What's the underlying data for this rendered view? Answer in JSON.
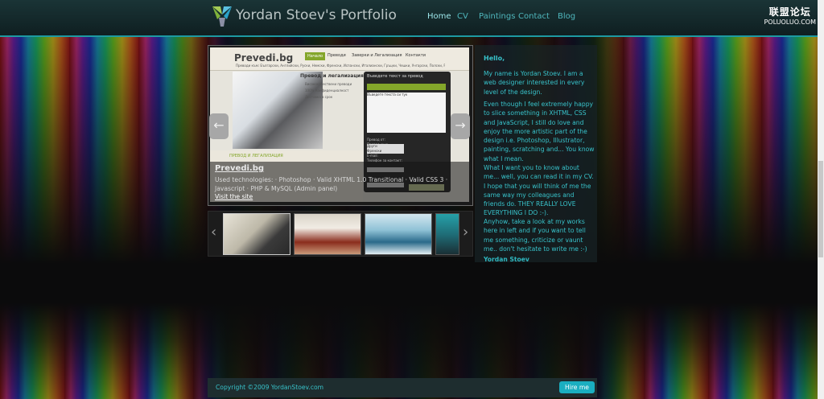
{
  "header": {
    "title": "Yordan Stoev's Portfolio",
    "nav": [
      {
        "label": "Home",
        "active": true
      },
      {
        "label": "CV",
        "active": false
      },
      {
        "label": "Paintings",
        "active": false
      },
      {
        "label": "Contact",
        "active": false
      },
      {
        "label": "Blog",
        "active": false
      }
    ]
  },
  "watermark": {
    "line1": "联盟论坛",
    "line2": "POLUOLUO.COM"
  },
  "slider": {
    "project_title": "Prevedi.bg",
    "technologies": "Used technologies: · Photoshop · Valid XHTML 1.0 Transitional · Valid CSS 3 · Javascript · PHP & MySQL (Admin panel)",
    "visit_label": "Visit the site",
    "prev_icon": "←",
    "next_icon": "→",
    "screenshot": {
      "logo": "Prevedi.bg",
      "nav": [
        "Начало",
        "Преводи",
        "Заверки и Легализация",
        "Контакти"
      ],
      "languages": "Преводи към: Български, Английски, Руски, Немски, Френски, Испански, Италиански, Гръцки, Чешки, Унгарски, Полски, Румънски и др.",
      "subtitle": "Превод и легализация",
      "bullets": [
        "Висококачествени преводи",
        "100% Конфиденциалност",
        "Доставка в срок"
      ],
      "form_title": "Въведете текст за превод",
      "textarea": "Въведете текста си тук",
      "from_label": "Превод от:",
      "to_label": "Превод към:",
      "from_value": "Други",
      "to_value": "Френски",
      "email_label": "E-mail:",
      "phone_label": "Телефон за контакт:",
      "section_title": "ПРЕВОД И ЛЕГАЛИЗАЦИЯ"
    }
  },
  "thumbnails": {
    "prev_icon": "‹",
    "next_icon": "›",
    "items": [
      {
        "colors": [
          "#e8e4d8",
          "#3a3a3a"
        ]
      },
      {
        "colors": [
          "#d9d3c8",
          "#8a2c1c"
        ]
      },
      {
        "colors": [
          "#d4e7ef",
          "#2a6a8a"
        ]
      },
      {
        "colors": [
          "#26a0a8",
          "#1a2f35"
        ]
      }
    ]
  },
  "about": {
    "greeting": "Hello,",
    "paragraphs": [
      "My name is Yordan Stoev. I am a web designer interested in every level of the design.",
      "Even though I feel extremely happy to slice something in XHTML, CSS and JavaScript, I still do love and enjoy the more artistic part of the design i.e. Photoshop, Illustrator, painting, scratching and... You know what I mean.",
      "What I want you to know about me... well, you can read it in my CV. I hope that you will think of me the same way my colleagues and friends do. THEY REALLY LOVE EVERYTHING I DO :-).",
      "Anyhow, take a look at my works here in left and if you want to tell me something, criticize or vaunt me.. don't hesitate to write me :-)"
    ],
    "signature": "Yordan Stoev"
  },
  "footer": {
    "copyright": "Copyright ©2009 YordanStoev.com",
    "hire_label": "Hire me"
  },
  "colors": {
    "accent": "#38c3cb",
    "nav": "#4fb7bd",
    "hire_button": "#1aaec0"
  }
}
